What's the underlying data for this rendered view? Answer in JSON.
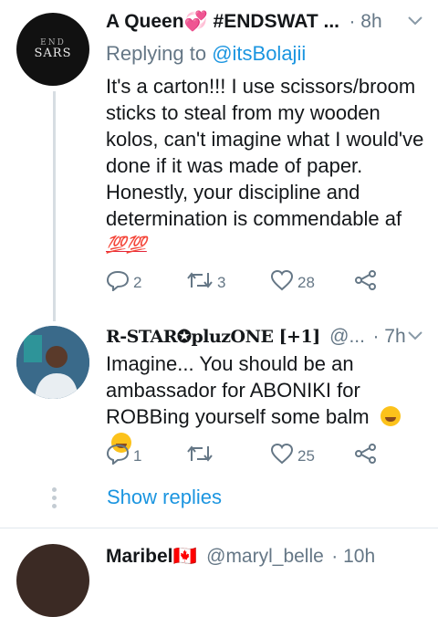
{
  "tweet1": {
    "name": "A Queen💞 #ENDSWAT ...",
    "time": "· 8h",
    "avatar_text_top": "END",
    "avatar_text_bottom": "SARS",
    "replying_prefix": "Replying to ",
    "replying_mention": "@itsBolajii",
    "lines": [
      "It's a carton!!! I use scissors/broom",
      "sticks to steal from my wooden",
      "kolos, can't imagine what I would've",
      "done if it was made of paper.",
      "Honestly, your discipline and",
      "determination is commendable af"
    ],
    "emoji_line": "💯💯",
    "reply_count": "2",
    "retweet_count": "3",
    "like_count": "28"
  },
  "tweet2": {
    "name": "R-STAR✪pluzONE [+1]",
    "handle": "@...",
    "time": "· 7h",
    "lines": [
      "Imagine... You should be an",
      "ambassador for ABONIKI for",
      "ROBBing yourself some balm"
    ],
    "reply_count": "1",
    "retweet_count": "",
    "like_count": "25"
  },
  "show_replies": "Show replies",
  "tweet3": {
    "name": "Maribel🇨🇦",
    "handle": "@maryl_belle",
    "time": "· 10h"
  },
  "colors": {
    "accent": "#1b95e0",
    "muted": "#657786",
    "text": "#14171a"
  }
}
